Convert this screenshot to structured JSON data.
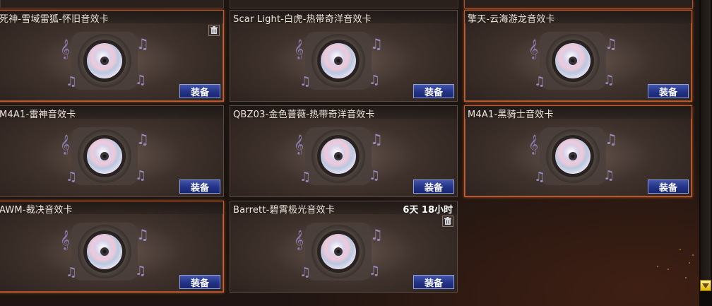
{
  "cards": [
    {
      "name": "死神-雪域雷狐-怀旧音效卡",
      "equip_label": "装备",
      "timer": "",
      "highlighted": true,
      "trash": true
    },
    {
      "name": "Scar Light-白虎-热带奇洋音效卡",
      "equip_label": "装备",
      "timer": "",
      "highlighted": false,
      "trash": false
    },
    {
      "name": "擎天-云海游龙音效卡",
      "equip_label": "装备",
      "timer": "",
      "highlighted": true,
      "trash": false
    },
    {
      "name": "M4A1-雷神音效卡",
      "equip_label": "装备",
      "timer": "",
      "highlighted": false,
      "trash": false
    },
    {
      "name": "QBZ03-金色蔷薇-热带奇洋音效卡",
      "equip_label": "装备",
      "timer": "",
      "highlighted": false,
      "trash": false
    },
    {
      "name": "M4A1-黑骑士音效卡",
      "equip_label": "装备",
      "timer": "",
      "highlighted": true,
      "trash": false
    },
    {
      "name": "AWM-裁决音效卡",
      "equip_label": "装备",
      "timer": "",
      "highlighted": true,
      "trash": false
    },
    {
      "name": "Barrett-碧霄极光音效卡",
      "equip_label": "装备",
      "timer": "6天 18小时",
      "highlighted": false,
      "trash": true
    }
  ],
  "icons": {
    "card_art": "music-disc-icon",
    "trash": "trash-icon",
    "scroll_down": "chevron-down-icon"
  },
  "colors": {
    "highlight_border": "#c85a2c",
    "equip_button": "#233388",
    "scroll_arrow": "#e0b400"
  }
}
